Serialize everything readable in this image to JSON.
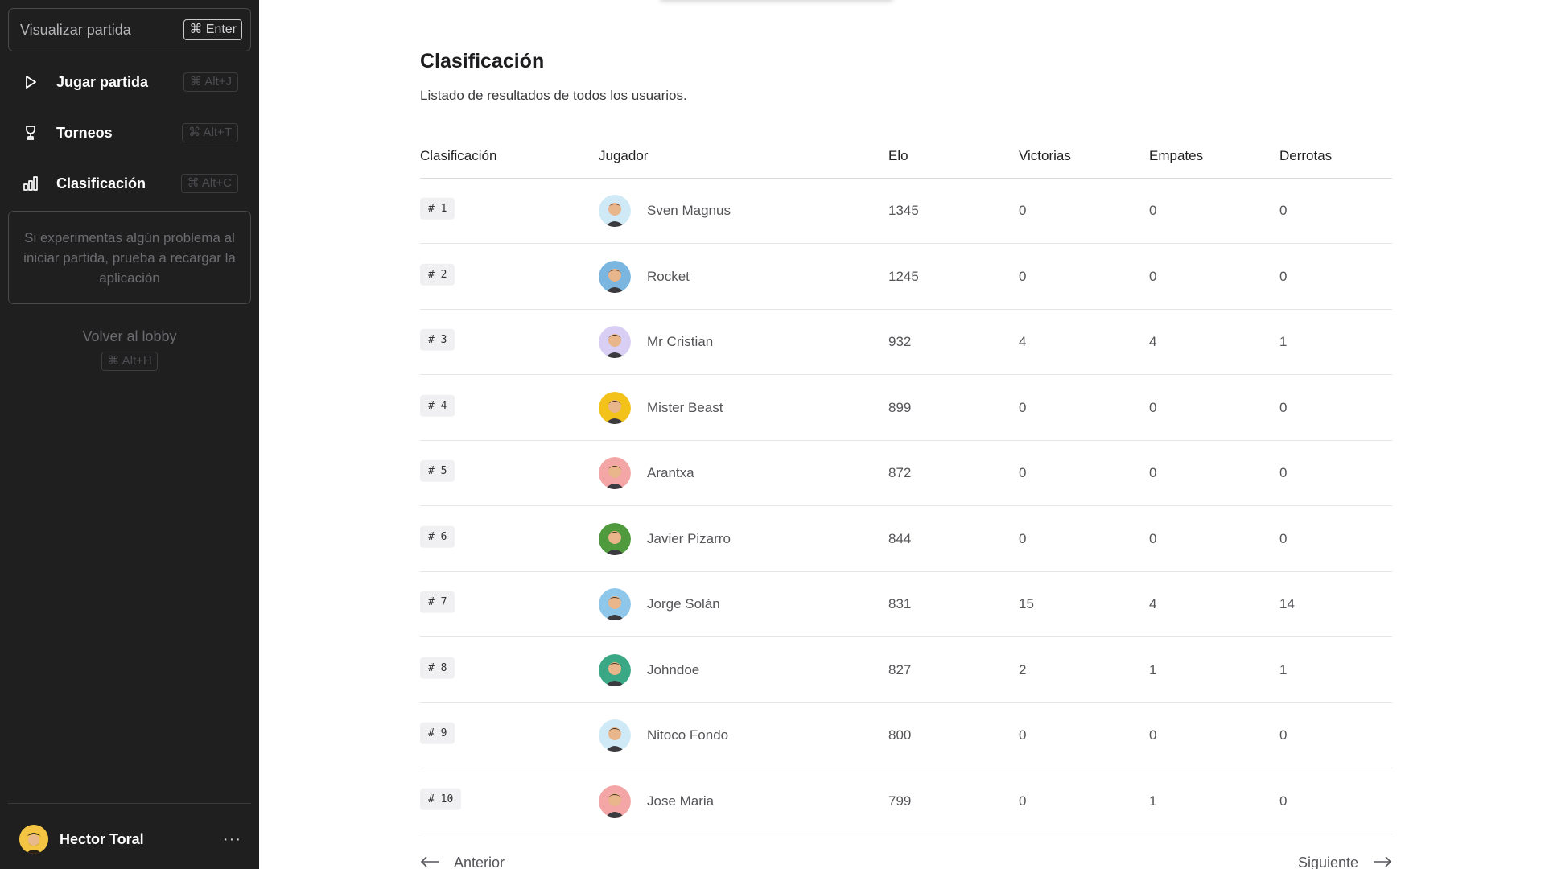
{
  "sidebar": {
    "search": {
      "placeholder": "Visualizar partida",
      "shortcut": "⌘ Enter"
    },
    "nav": [
      {
        "label": "Jugar partida",
        "shortcut": "⌘ Alt+J",
        "icon": "play-icon"
      },
      {
        "label": "Torneos",
        "shortcut": "⌘ Alt+T",
        "icon": "trophy-icon"
      },
      {
        "label": "Clasificación",
        "shortcut": "⌘ Alt+C",
        "icon": "bar-chart-icon"
      }
    ],
    "info": "Si experimentas algún problema al iniciar partida, prueba a recargar la aplicación",
    "lobby": {
      "label": "Volver al lobby",
      "shortcut": "⌘ Alt+H"
    },
    "user": {
      "name": "Hector Toral",
      "more": "···"
    }
  },
  "main": {
    "title": "Clasificación",
    "subtitle": "Listado de resultados de todos los usuarios.",
    "headers": {
      "rank": "Clasificación",
      "player": "Jugador",
      "elo": "Elo",
      "wins": "Victorias",
      "draws": "Empates",
      "losses": "Derrotas"
    },
    "rows": [
      {
        "rank": "# 1",
        "player": "Sven Magnus",
        "elo": "1345",
        "wins": "0",
        "draws": "0",
        "losses": "0",
        "avatar_color": "#cfe9f7"
      },
      {
        "rank": "# 2",
        "player": "Rocket",
        "elo": "1245",
        "wins": "0",
        "draws": "0",
        "losses": "0",
        "avatar_color": "#7bb6e0"
      },
      {
        "rank": "# 3",
        "player": "Mr Cristian",
        "elo": "932",
        "wins": "4",
        "draws": "4",
        "losses": "1",
        "avatar_color": "#d9cff5"
      },
      {
        "rank": "# 4",
        "player": "Mister Beast",
        "elo": "899",
        "wins": "0",
        "draws": "0",
        "losses": "0",
        "avatar_color": "#f2c21a"
      },
      {
        "rank": "# 5",
        "player": "Arantxa",
        "elo": "872",
        "wins": "0",
        "draws": "0",
        "losses": "0",
        "avatar_color": "#f4a5a5"
      },
      {
        "rank": "# 6",
        "player": "Javier Pizarro",
        "elo": "844",
        "wins": "0",
        "draws": "0",
        "losses": "0",
        "avatar_color": "#4f9a3d"
      },
      {
        "rank": "# 7",
        "player": "Jorge Solán",
        "elo": "831",
        "wins": "15",
        "draws": "4",
        "losses": "14",
        "avatar_color": "#8fc7ea"
      },
      {
        "rank": "# 8",
        "player": "Johndoe",
        "elo": "827",
        "wins": "2",
        "draws": "1",
        "losses": "1",
        "avatar_color": "#3aa884"
      },
      {
        "rank": "# 9",
        "player": "Nitoco Fondo",
        "elo": "800",
        "wins": "0",
        "draws": "0",
        "losses": "0",
        "avatar_color": "#cfe9f7"
      },
      {
        "rank": "# 10",
        "player": "Jose Maria",
        "elo": "799",
        "wins": "0",
        "draws": "1",
        "losses": "0",
        "avatar_color": "#f4a5a5"
      }
    ],
    "pager": {
      "prev": "Anterior",
      "next": "Siguiente"
    }
  }
}
